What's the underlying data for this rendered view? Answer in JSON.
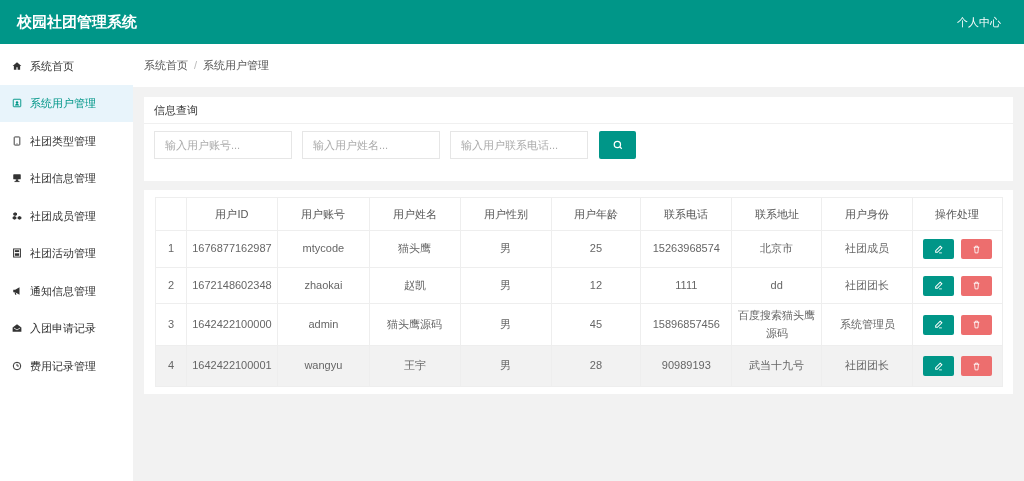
{
  "header": {
    "title": "校园社团管理系统",
    "user_menu": "个人中心"
  },
  "sidebar": {
    "items": [
      {
        "label": "系统首页",
        "selected": false
      },
      {
        "label": "系统用户管理",
        "selected": true
      },
      {
        "label": "社团类型管理",
        "selected": false
      },
      {
        "label": "社团信息管理",
        "selected": false
      },
      {
        "label": "社团成员管理",
        "selected": false
      },
      {
        "label": "社团活动管理",
        "selected": false
      },
      {
        "label": "通知信息管理",
        "selected": false
      },
      {
        "label": "入团申请记录",
        "selected": false
      },
      {
        "label": "费用记录管理",
        "selected": false
      }
    ]
  },
  "breadcrumb": {
    "items": [
      "系统首页",
      "系统用户管理"
    ],
    "separator": "/"
  },
  "search": {
    "title": "信息查询",
    "fields": [
      {
        "placeholder": "输入用户账号..."
      },
      {
        "placeholder": "输入用户姓名..."
      },
      {
        "placeholder": "输入用户联系电话..."
      }
    ]
  },
  "table": {
    "columns": [
      "",
      "用户ID",
      "用户账号",
      "用户姓名",
      "用户性别",
      "用户年龄",
      "联系电话",
      "联系地址",
      "用户身份",
      "操作处理"
    ],
    "rows": [
      {
        "selected": false,
        "cells": [
          "1",
          "1676877162987",
          "mtycode",
          "猫头鹰",
          "男",
          "25",
          "15263968574",
          "北京市",
          "社团成员"
        ]
      },
      {
        "selected": false,
        "cells": [
          "2",
          "1672148602348",
          "zhaokai",
          "赵凯",
          "男",
          "12",
          "1111",
          "dd",
          "社团团长"
        ]
      },
      {
        "selected": false,
        "cells": [
          "3",
          "1642422100000",
          "admin",
          "猫头鹰源码",
          "男",
          "45",
          "15896857456",
          "百度搜索猫头鹰源码",
          "系统管理员"
        ]
      },
      {
        "selected": true,
        "cells": [
          "4",
          "1642422100001",
          "wangyu",
          "王宇",
          "男",
          "28",
          "90989193",
          "武当十九号",
          "社团团长"
        ]
      }
    ]
  }
}
